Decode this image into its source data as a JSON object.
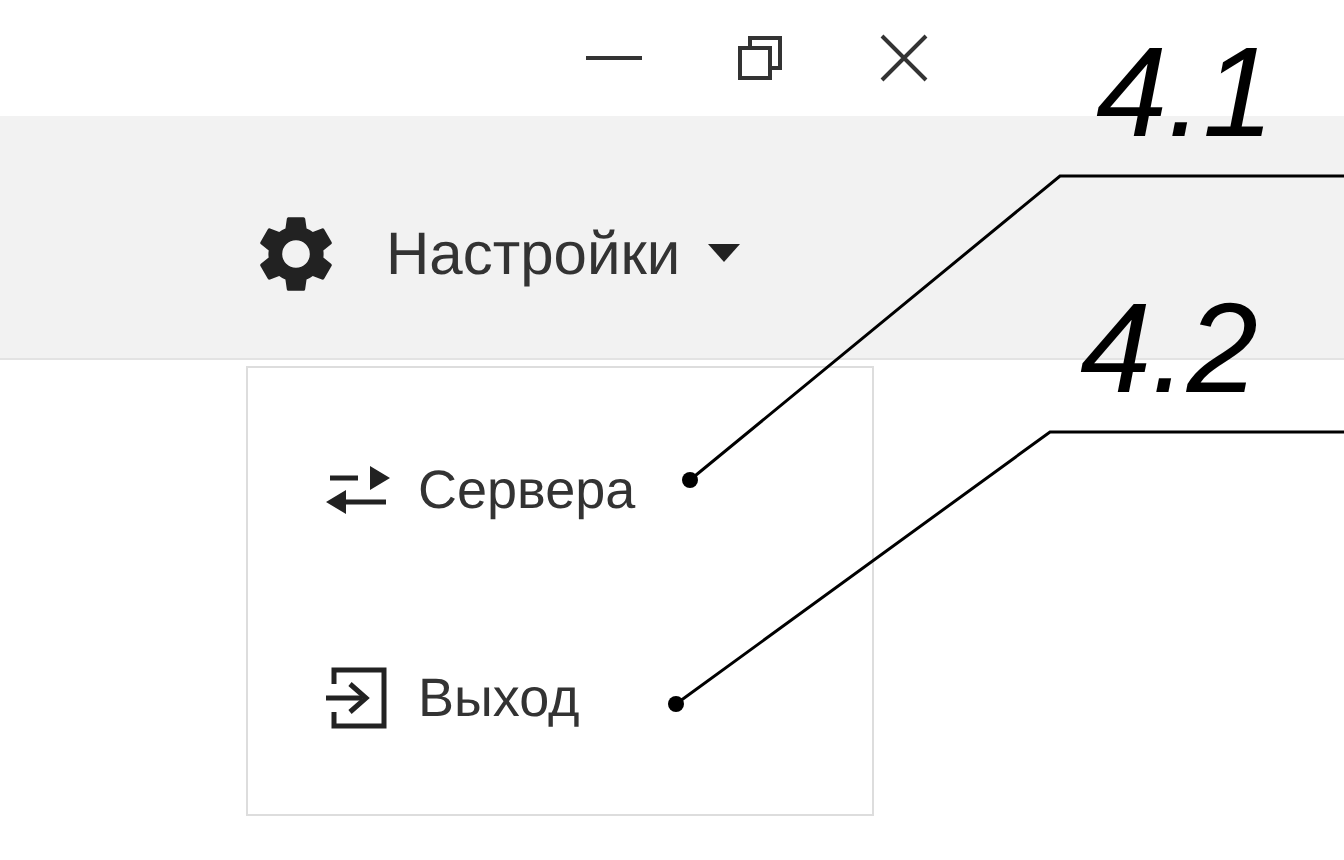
{
  "settings_menu": {
    "label": "Настройки",
    "expanded": true,
    "items": [
      {
        "label": "Сервера",
        "kind": "servers"
      },
      {
        "label": "Выход",
        "kind": "exit"
      }
    ]
  },
  "callouts": [
    {
      "label": "4.1"
    },
    {
      "label": "4.2"
    }
  ]
}
